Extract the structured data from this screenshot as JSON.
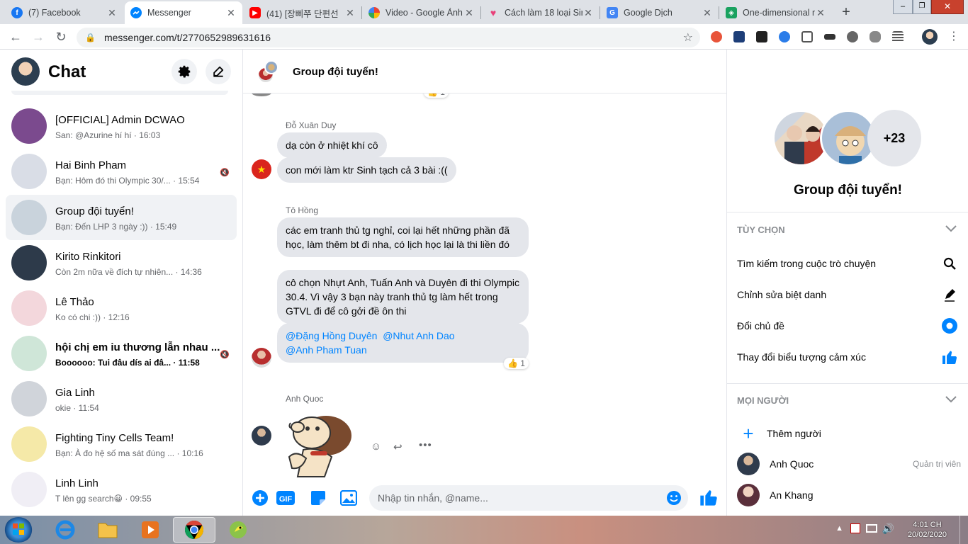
{
  "browser": {
    "tabs": [
      {
        "title": "(7) Facebook",
        "color": "#1877f2",
        "glyph": "f"
      },
      {
        "title": "Messenger",
        "color": "#0084ff",
        "glyph": "~"
      },
      {
        "title": "(41) [장삐쭈 단편선",
        "color": "#ff0000",
        "glyph": "▶"
      },
      {
        "title": "Video - Google Ảnh",
        "color": "#fbbc05",
        "glyph": "✱"
      },
      {
        "title": "Cách làm 18 loại Sir",
        "color": "#e8417a",
        "glyph": "♥"
      },
      {
        "title": "Google Dịch",
        "color": "#4285f4",
        "glyph": "G"
      },
      {
        "title": "One-dimensional m",
        "color": "#1aa260",
        "glyph": "◈"
      }
    ],
    "url": "messenger.com/t/2770652989631616"
  },
  "sidebar": {
    "title": "Chat",
    "conversations": [
      {
        "name": "[OFFICIAL] Admin DCWAO",
        "preview": "San: @Azurine hí hí · 16:03",
        "bold": false,
        "color": "#7b4a8e"
      },
      {
        "name": "Hai Binh Pham",
        "preview": "Bạn: Hôm đó thi Olympic 30/... · 15:54",
        "bold": false,
        "color": "#d9dde6"
      },
      {
        "name": "Group đội tuyển!",
        "preview": "Bạn: Đến LHP 3 ngày :)) · 15:49",
        "bold": false,
        "color": "#c9d3dc"
      },
      {
        "name": "Kirito Rinkitori",
        "preview": "Còn 2m nữa về đích tự nhiên... · 14:36",
        "bold": false,
        "color": "#2d3a4a"
      },
      {
        "name": "Lê Thảo",
        "preview": "Ko có chi :)) · 12:16",
        "bold": false,
        "color": "#f3d7dc"
      },
      {
        "name": "hội chị em iu thương lẫn nhau ...",
        "preview": "Boooooo: Tui đâu dís ai đâ... · 11:58",
        "bold": true,
        "color": "#cfe6d8"
      },
      {
        "name": "Gia Linh",
        "preview": "okie · 11:54",
        "bold": false,
        "color": "#d0d4da"
      },
      {
        "name": "Fighting Tiny Cells Team!",
        "preview": "Bạn: À đo hệ số ma sát đúng ... · 10:16",
        "bold": false,
        "color": "#f5e9a8"
      },
      {
        "name": "Linh Linh",
        "preview": "T lên gg search😀 · 09:55",
        "bold": false,
        "color": "#f0eef5"
      }
    ]
  },
  "conversation": {
    "name": "Group đội tuyển!",
    "input_placeholder": "Nhập tin nhắn, @name...",
    "blocks": [
      {
        "sender": "Đỗ Xuân Duy",
        "messages": [
          "dạ còn ở nhiệt khí cô",
          "con mới làm ktr Sinh tạch cả 3 bài :(("
        ]
      },
      {
        "sender": "Tô Hồng",
        "messages": [
          "các em tranh thủ tg nghỉ, coi lại hết những phần đã học, làm thêm bt đi nha, có lịch học lại là thi liền đó",
          "cô chọn Nhựt Anh, Tuấn Anh và Duyên đi thi Olympic 30.4. Vì vậy 3 bạn này tranh thủ tg làm hết trong GTVL đi để cô gởi đề ôn thi"
        ]
      },
      {
        "sender": "Anh Quoc",
        "messages": []
      }
    ],
    "mentions": [
      "@Đặng Hồng Duyên",
      "@Nhut Anh Dao",
      "@Anh Pham Tuan"
    ],
    "reaction_count": "1"
  },
  "info": {
    "name": "Group đội tuyển!",
    "extra_members": "+23",
    "options_title": "TÙY CHỌN",
    "options": [
      "Tìm kiếm trong cuộc trò chuyện",
      "Chỉnh sửa biệt danh",
      "Đổi chủ đề",
      "Thay đổi biểu tượng cảm xúc"
    ],
    "people_title": "MỌI NGƯỜI",
    "add_people": "Thêm người",
    "people": [
      {
        "name": "Anh Quoc",
        "role": "Quản trị viên"
      },
      {
        "name": "An Khang",
        "role": ""
      }
    ]
  },
  "taskbar": {
    "time": "4:01 CH",
    "date": "20/02/2020"
  },
  "colors": {
    "accent": "#0084ff",
    "bubble": "#e4e6eb",
    "muted_text": "#65676b"
  }
}
